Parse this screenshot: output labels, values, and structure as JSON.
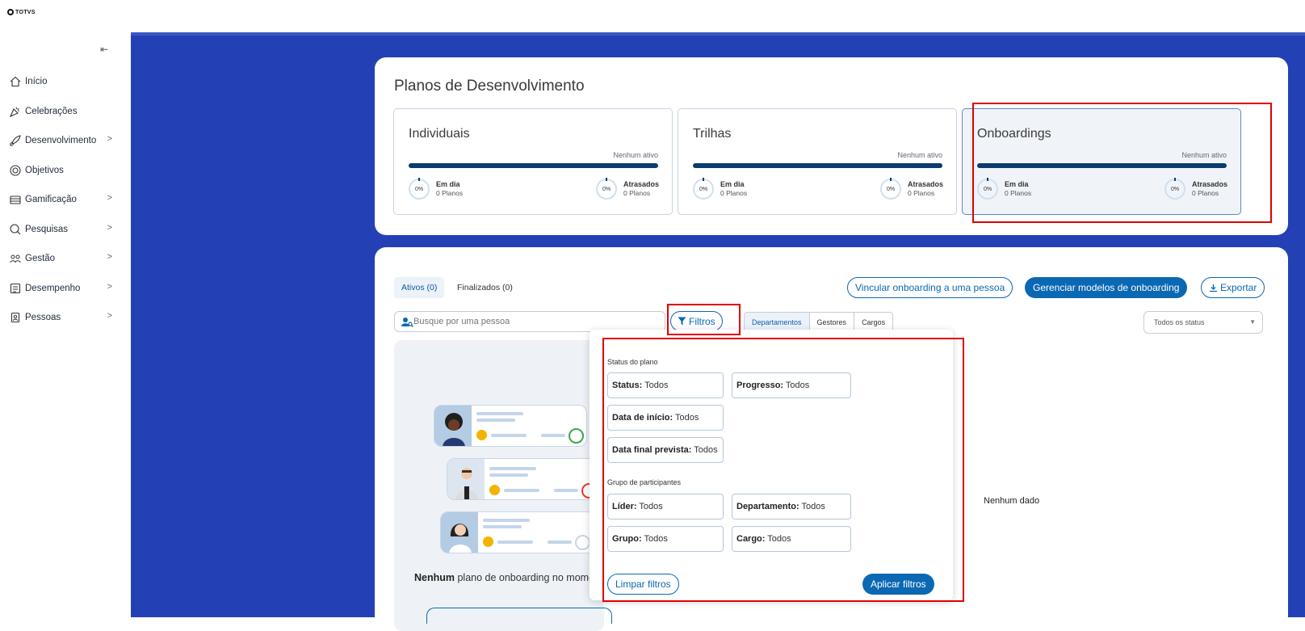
{
  "brand": {
    "logo_text": "TOTVS"
  },
  "sidebar": {
    "collapse_icon": "arrow-left-bar",
    "items": [
      {
        "label": "Início",
        "icon": "home-icon",
        "has_children": false
      },
      {
        "label": "Celebrações",
        "icon": "party-icon",
        "has_children": false
      },
      {
        "label": "Desenvolvimento",
        "icon": "rocket-icon",
        "has_children": true
      },
      {
        "label": "Objetivos",
        "icon": "target-icon",
        "has_children": false
      },
      {
        "label": "Gamificação",
        "icon": "coins-icon",
        "has_children": true
      },
      {
        "label": "Pesquisas",
        "icon": "search-doc-icon",
        "has_children": true
      },
      {
        "label": "Gestão",
        "icon": "team-icon",
        "has_children": true
      },
      {
        "label": "Desempenho",
        "icon": "checklist-icon",
        "has_children": true
      },
      {
        "label": "Pessoas",
        "icon": "badge-icon",
        "has_children": true
      }
    ]
  },
  "summary": {
    "title": "Planos de Desenvolvimento",
    "cards": [
      {
        "name": "Individuais",
        "status": "Nenhum ativo",
        "on_time_label": "Em dia",
        "on_time_value": "0 Planos",
        "on_time_pct": "0%",
        "late_label": "Atrasados",
        "late_value": "0 Planos",
        "late_pct": "0%"
      },
      {
        "name": "Trilhas",
        "status": "Nenhum ativo",
        "on_time_label": "Em dia",
        "on_time_value": "0 Planos",
        "on_time_pct": "0%",
        "late_label": "Atrasados",
        "late_value": "0 Planos",
        "late_pct": "0%"
      },
      {
        "name": "Onboardings",
        "status": "Nenhum ativo",
        "on_time_label": "Em dia",
        "on_time_value": "0 Planos",
        "on_time_pct": "0%",
        "late_label": "Atrasados",
        "late_value": "0 Planos",
        "late_pct": "0%"
      }
    ]
  },
  "list": {
    "tabs": [
      "Ativos (0)",
      "Finalizados (0)"
    ],
    "link_button": "Vincular onboarding a uma pessoa",
    "manage_button": "Gerenciar modelos de onboarding",
    "export_button": "Exportar",
    "search_placeholder": "Busque por uma pessoa",
    "filters_button": "Filtros",
    "segments": [
      "Departamentos",
      "Gestores",
      "Cargos"
    ],
    "status_select": "Todos os status",
    "empty_bold": "Nenhum",
    "empty_text": " plano de onboarding no mome",
    "no_data": "Nenhum dado"
  },
  "filters": {
    "section1": "Status do plano",
    "section2": "Grupo de participantes",
    "fields": {
      "status_label": "Status:",
      "status_value": " Todos",
      "progress_label": "Progresso:",
      "progress_value": " Todos",
      "start_label": "Data de início:",
      "start_value": " Todos",
      "end_label": "Data final prevista:",
      "end_value": " Todos",
      "leader_label": "Líder:",
      "leader_value": " Todos",
      "dept_label": "Departamento:",
      "dept_value": " Todos",
      "group_label": "Grupo:",
      "group_value": " Todos",
      "role_label": "Cargo:",
      "role_value": " Todos"
    },
    "clear_button": "Limpar filtros",
    "apply_button": "Aplicar filtros"
  },
  "colors": {
    "primary": "#0b68b3",
    "background": "#2341b5",
    "highlight": "#e10000"
  }
}
